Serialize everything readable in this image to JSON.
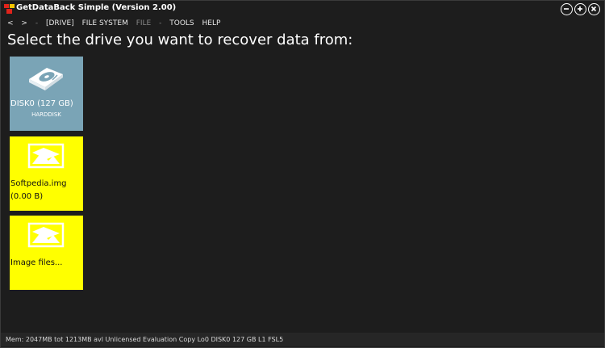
{
  "window": {
    "title": "GetDataBack Simple (Version 2.00)"
  },
  "menu": {
    "back": "<",
    "forward": ">",
    "separator": "-",
    "items": [
      "[DRIVE]",
      "FILE SYSTEM",
      "FILE",
      "TOOLS",
      "HELP"
    ]
  },
  "main": {
    "heading": "Select the drive you want to recover data from:"
  },
  "drives": [
    {
      "name": "DISK0 (127 GB)",
      "subtitle": "HARDDISK",
      "icon": "harddisk-icon",
      "color": "#7aa4b6"
    },
    {
      "name": "Softpedia.img",
      "name2": "(0.00 B)",
      "icon": "image-file-icon",
      "color": "#ffff00"
    },
    {
      "name": "Image files...",
      "icon": "image-file-icon",
      "color": "#ffff00"
    }
  ],
  "status": {
    "text": "Mem: 2047MB tot 1213MB avl  Unlicensed Evaluation Copy  Lo0  DISK0 127 GB L1 FSL5"
  }
}
